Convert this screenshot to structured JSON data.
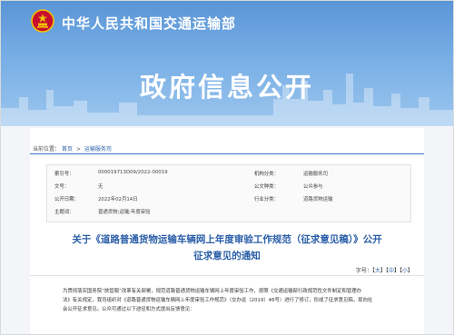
{
  "header": {
    "ministry_name": "中华人民共和国交通运输部",
    "portal_title": "政府信息公开",
    "emblem_icon": "national-emblem-icon"
  },
  "breadcrumb": {
    "prefix": "当前位置：",
    "home": "首页",
    "sep": ">",
    "current": "运输服务司"
  },
  "meta": {
    "index_label": "索引号：",
    "index_value": "000019713O09/2022-00019",
    "org_label": "机构分类：",
    "org_value": "运输服务司",
    "docno_label": "文号：",
    "docno_value": "无",
    "pubtype_label": "公文种类：",
    "pubtype_value": "公众参与",
    "date_label": "公开日期：",
    "date_value": "2022年02月14日",
    "industry_label": "行业分类：",
    "industry_value": "道路货物运输",
    "keyword_label": "主题词：",
    "keyword_value": "普通货物;运输;年度审验"
  },
  "article": {
    "title_line1": "关于《道路普通货物运输车辆网上年度审验工作规范（征求意见稿）》公开",
    "title_line2": "征求意见的通知"
  },
  "font_size": {
    "label": "字号：",
    "large": "大",
    "medium": "中",
    "small": "小"
  },
  "body": {
    "line1": "为贯彻落实国务院“放管服”改革有关部署，规范道路普通货物运输车辆网上年度审验工作，按照《交通运输部行政规范性文件制定和管理办",
    "line2": "法》有关规定，我司组织对《道路普通货物运输车辆网上年度审验工作规范》（交办运〔2019〕46号）进行了修订，形成了征求意见稿，现向社",
    "line3": "会公开征求意见。公众可通过以下途径和方式提出反馈意见："
  },
  "colors": {
    "accent": "#2a5ea8",
    "banner_top": "#5a95d6",
    "banner_bottom": "#9cc6ee"
  }
}
